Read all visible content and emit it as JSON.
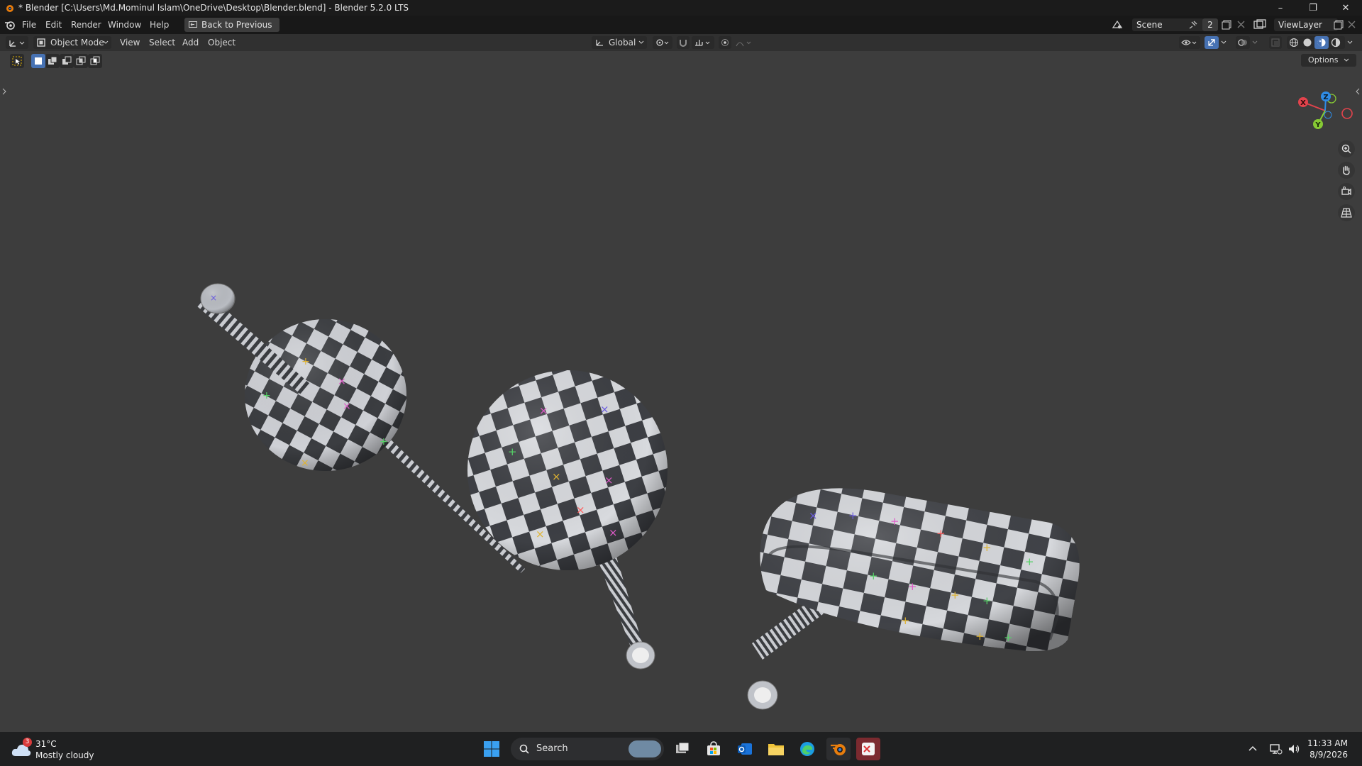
{
  "window": {
    "title": "* Blender [C:\\Users\\Md.Mominul Islam\\OneDrive\\Desktop\\Blender.blend] - Blender 5.2.0 LTS",
    "minimize": "–",
    "maximize": "❐",
    "close": "✕"
  },
  "topbar": {
    "menus": [
      "File",
      "Edit",
      "Render",
      "Window",
      "Help"
    ],
    "back_label": "Back to Previous",
    "scene_label": "Scene",
    "scene_count": "2",
    "view_layer": "ViewLayer"
  },
  "header": {
    "mode": "Object Mode",
    "menus": [
      "View",
      "Select",
      "Add",
      "Object"
    ],
    "transform_orientation": "Global"
  },
  "viewport": {
    "options_label": "Options",
    "gizmo_axes": [
      "X",
      "Z",
      "Y"
    ],
    "colors": {
      "x": "#e2434c",
      "y": "#86c934",
      "z": "#2f8ce6",
      "background": "#3d3d3d"
    }
  },
  "taskbar": {
    "weather_temp": "31°C",
    "weather_desc": "Mostly cloudy",
    "weather_badge": "3",
    "search_placeholder": "Search",
    "time": "11:33 AM",
    "date": "8/9/2026"
  }
}
